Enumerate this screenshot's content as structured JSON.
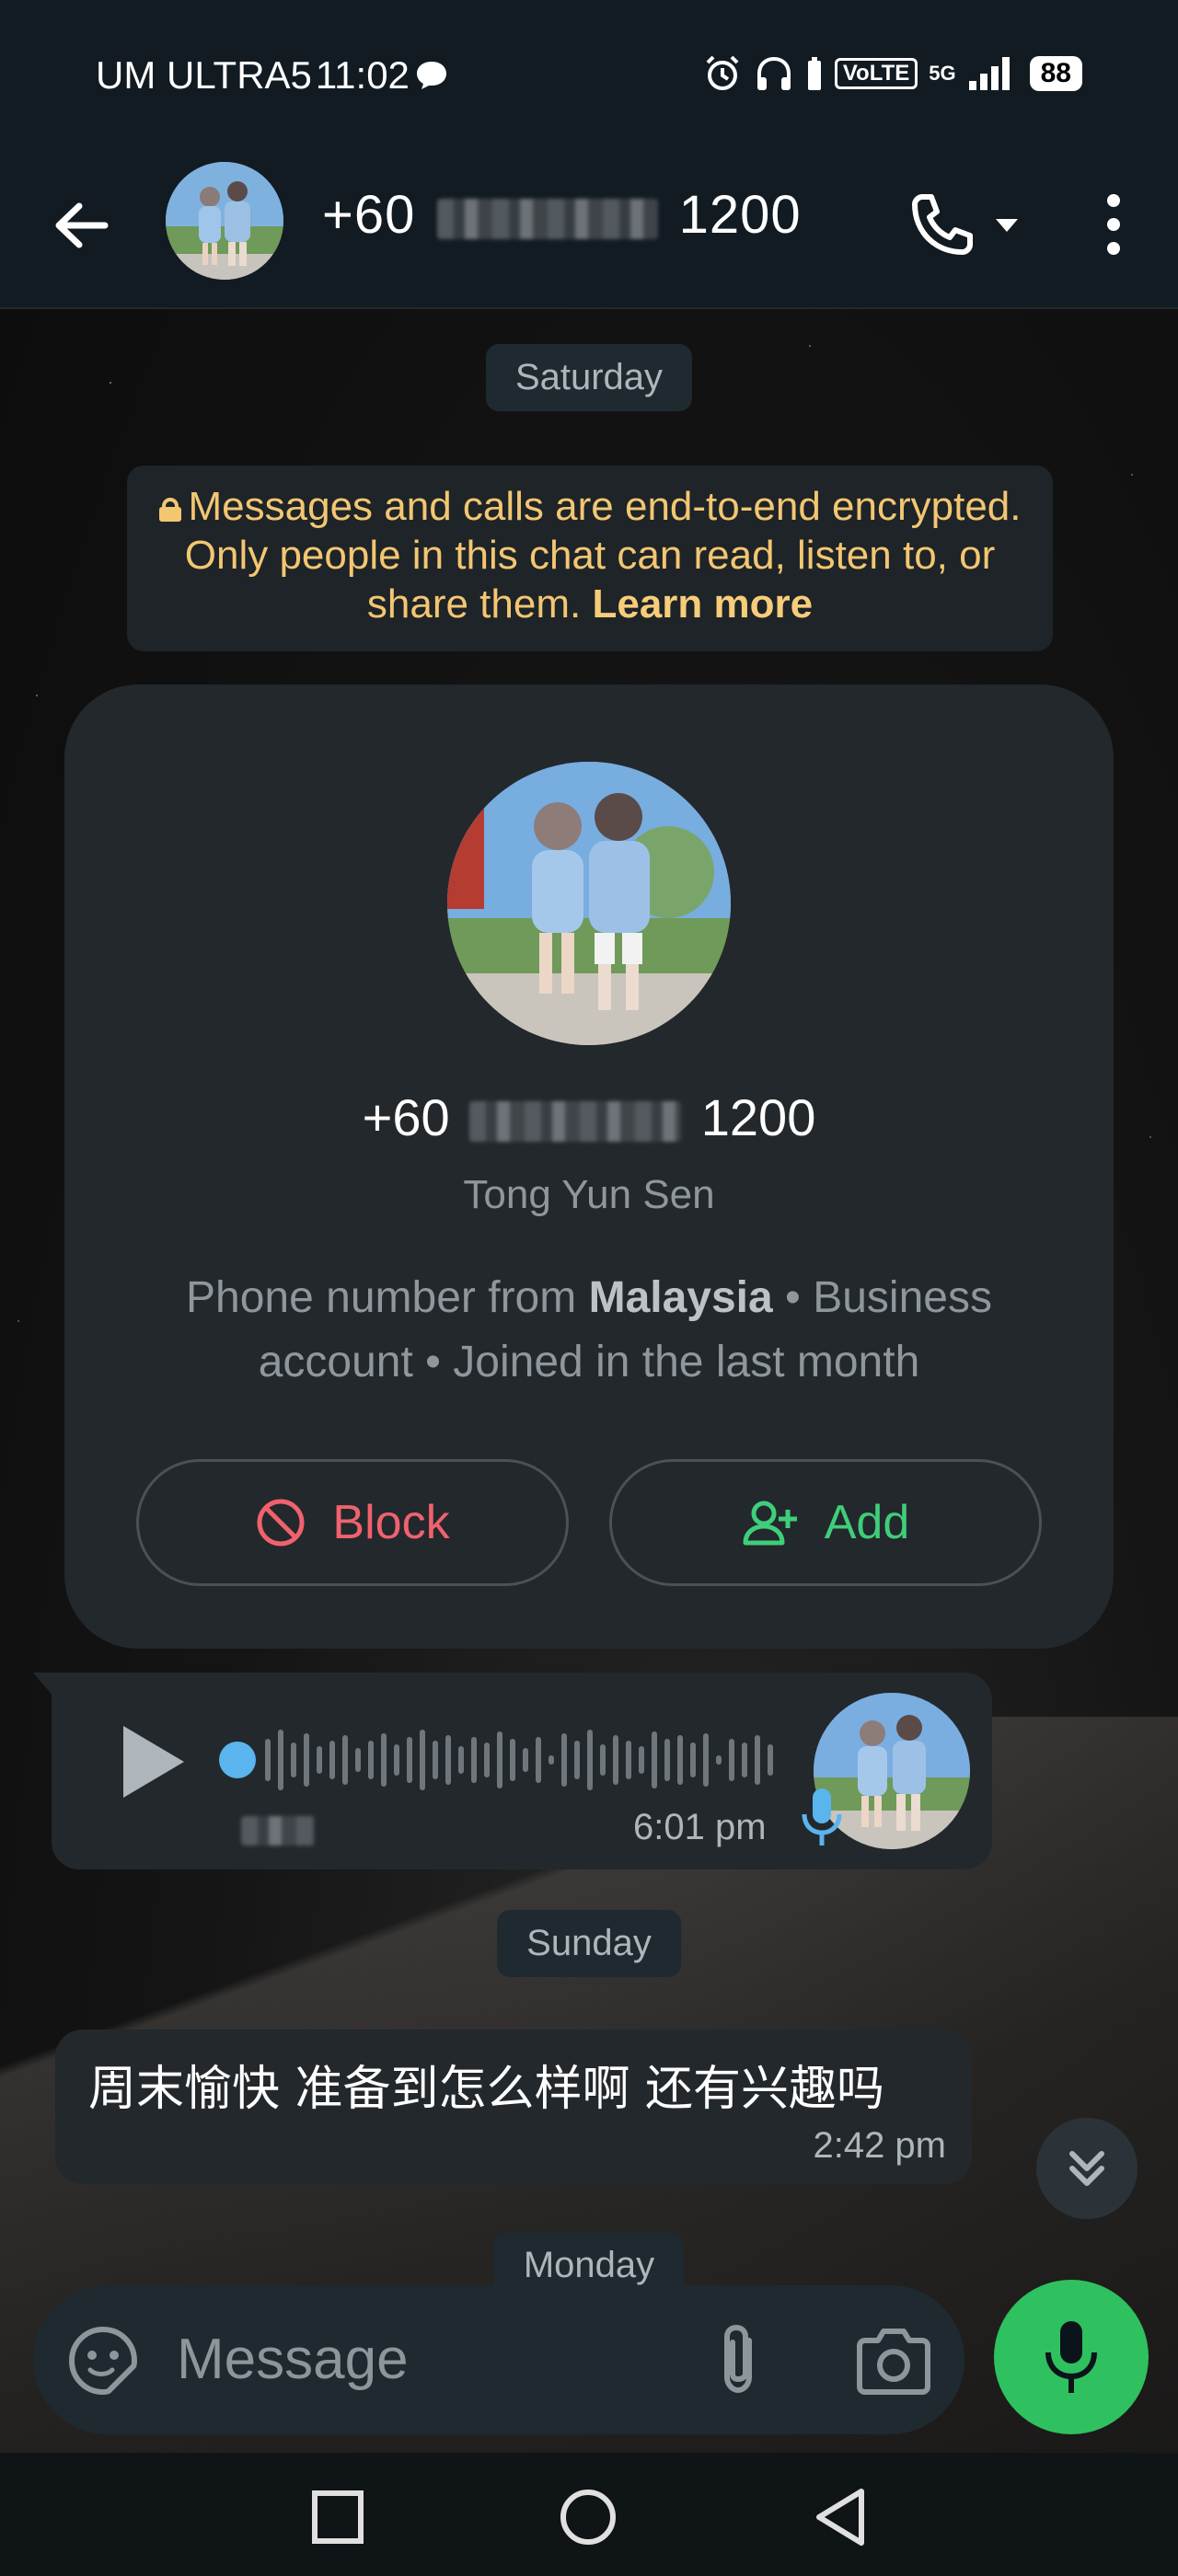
{
  "status_bar": {
    "carrier": "UM ULTRA5",
    "time": "11:02",
    "network": "5G",
    "volte": "VoLTE",
    "battery": "88"
  },
  "header": {
    "number_prefix": "+60",
    "number_suffix": "1200"
  },
  "chat": {
    "date_saturday": "Saturday",
    "encryption_text": "Messages and calls are end-to-end encrypted. Only people in this chat can read, listen to, or share them.",
    "encryption_link": "Learn more",
    "profile": {
      "number_prefix": "+60",
      "number_suffix": "1200",
      "name": "Tong Yun Sen",
      "info_pre": "Phone number from ",
      "country": "Malaysia",
      "info_post": " • Business account • Joined in the last month",
      "block_label": "Block",
      "add_label": "Add"
    },
    "voice_message": {
      "time": "6:01 pm"
    },
    "date_sunday": "Sunday",
    "text_message": {
      "body": "周末愉快 准备到怎么样啊 还有兴趣吗",
      "time": "2:42 pm"
    },
    "date_monday": "Monday"
  },
  "composer": {
    "placeholder": "Message"
  },
  "colors": {
    "accent_green": "#2fc15f",
    "block_red": "#f0626e",
    "add_green": "#3fce7a",
    "encryption_yellow": "#f3c672"
  }
}
